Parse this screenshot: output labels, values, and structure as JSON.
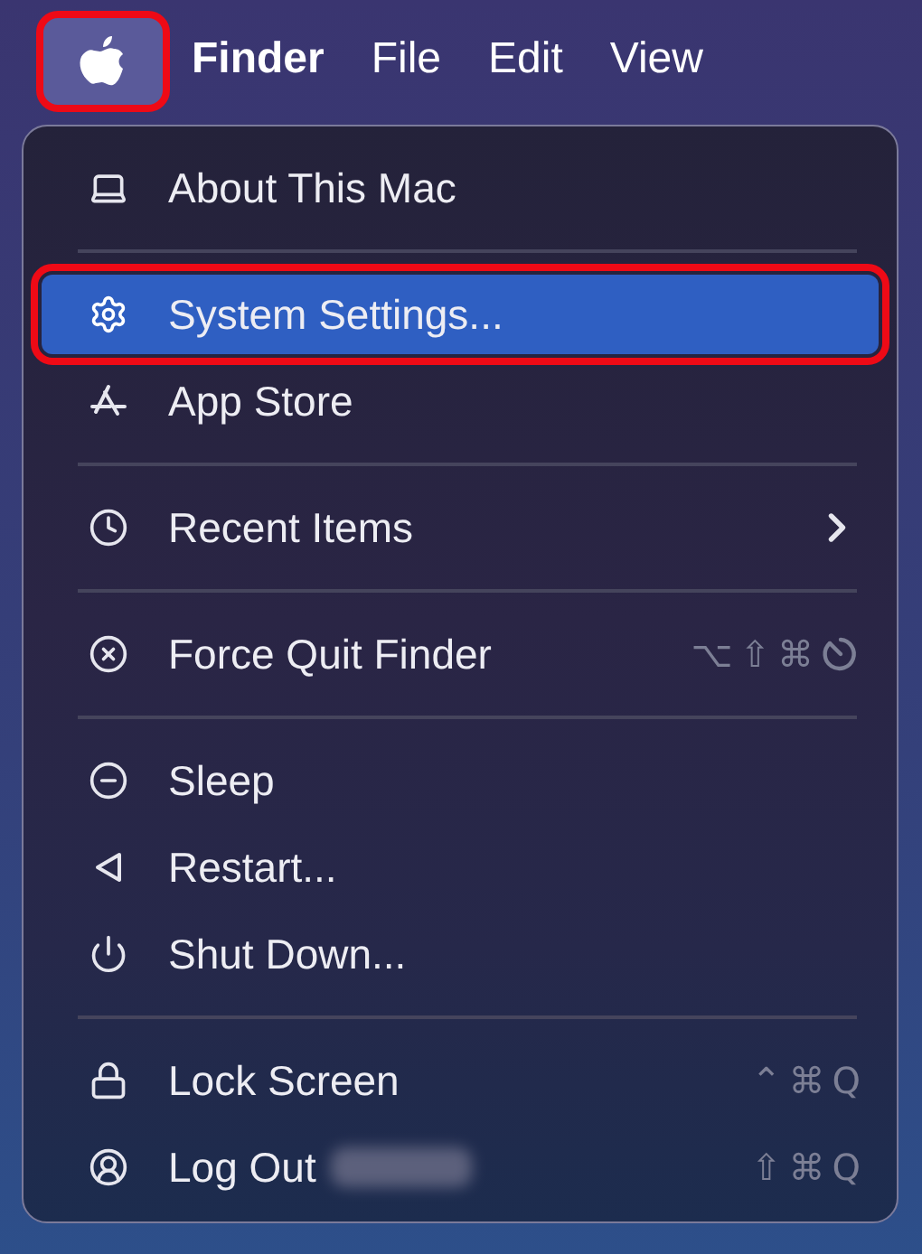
{
  "menu_bar": {
    "apple_highlighted": true,
    "items": [
      {
        "label": "Finder",
        "selected": true
      },
      {
        "label": "File",
        "selected": false
      },
      {
        "label": "Edit",
        "selected": false
      },
      {
        "label": "View",
        "selected": false
      }
    ]
  },
  "menu": {
    "groups": [
      {
        "items": [
          {
            "kind": "laptop",
            "label": "About This Mac",
            "selected": false,
            "highlighted": false
          }
        ]
      },
      {
        "items": [
          {
            "kind": "gear",
            "label": "System Settings...",
            "selected": true,
            "highlighted": true
          },
          {
            "kind": "appstore",
            "label": "App Store",
            "selected": false,
            "highlighted": false
          }
        ]
      },
      {
        "items": [
          {
            "kind": "clock",
            "label": "Recent Items",
            "selected": false,
            "highlighted": false,
            "submenu": true
          }
        ]
      },
      {
        "items": [
          {
            "kind": "xcircle",
            "label": "Force Quit Finder",
            "selected": false,
            "highlighted": false,
            "shortcut": [
              {
                "kind": "char",
                "text": "⌥"
              },
              {
                "kind": "char",
                "text": "⇧"
              },
              {
                "kind": "char",
                "text": "⌘"
              },
              {
                "kind": "escape"
              }
            ]
          }
        ]
      },
      {
        "items": [
          {
            "kind": "minuscircle",
            "label": "Sleep",
            "selected": false,
            "highlighted": false
          },
          {
            "kind": "triangle",
            "label": "Restart...",
            "selected": false,
            "highlighted": false
          },
          {
            "kind": "power",
            "label": "Shut Down...",
            "selected": false,
            "highlighted": false
          }
        ]
      },
      {
        "items": [
          {
            "kind": "lock",
            "label": "Lock Screen",
            "selected": false,
            "highlighted": false,
            "shortcut": [
              {
                "kind": "char",
                "text": "⌃"
              },
              {
                "kind": "char",
                "text": "⌘"
              },
              {
                "kind": "char",
                "text": "Q"
              }
            ]
          },
          {
            "kind": "user",
            "label": "Log Out",
            "selected": false,
            "highlighted": false,
            "redacted": true,
            "shortcut": [
              {
                "kind": "char",
                "text": "⇧"
              },
              {
                "kind": "char",
                "text": "⌘"
              },
              {
                "kind": "char",
                "text": "Q"
              }
            ]
          }
        ]
      }
    ]
  }
}
